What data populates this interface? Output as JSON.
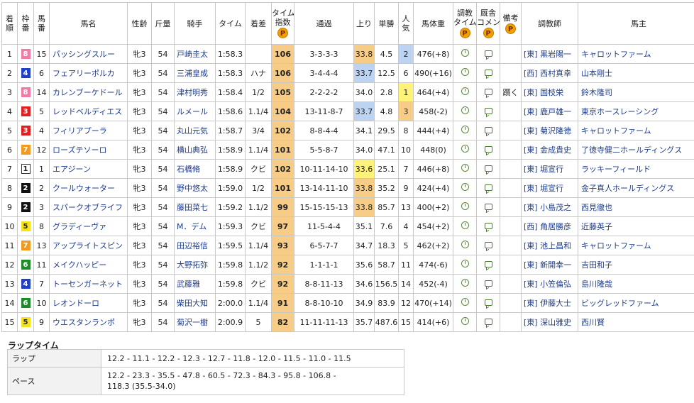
{
  "headers": {
    "rank": [
      "着",
      "順"
    ],
    "waku": [
      "枠",
      "番"
    ],
    "umaban": [
      "馬",
      "番"
    ],
    "name": "馬名",
    "sexage": "性齢",
    "weight": "斤量",
    "jockey": "騎手",
    "time": "タイム",
    "margin": "着差",
    "index": [
      "タイム",
      "指数"
    ],
    "passing": "通過",
    "last3f": "上り",
    "odds": "単勝",
    "pop": [
      "人",
      "気"
    ],
    "bodyweight": "馬体重",
    "training": [
      "調教",
      "タイム"
    ],
    "comment": [
      "厩舎",
      "コメント"
    ],
    "note": "備考",
    "trainer": "調教師",
    "owner": "馬主",
    "premium_badge": "P"
  },
  "rows": [
    {
      "rank": "1",
      "waku": "8",
      "umaban": "15",
      "name": "パッシングスルー",
      "sexage": "牝3",
      "weight": "54",
      "jockey": "戸崎圭太",
      "time": "1:58.3",
      "margin": "",
      "index": "106",
      "passing": "3-3-3-3",
      "last3f": "33.8",
      "odds": "4.5",
      "pop": "2",
      "bodyweight": "476(+8)",
      "note": "",
      "trainer": "[東] 黒岩陽一",
      "owner": "キャロットファーム",
      "l3": "orange",
      "pp": "blue"
    },
    {
      "rank": "2",
      "waku": "4",
      "umaban": "6",
      "name": "フェアリーポルカ",
      "sexage": "牝3",
      "weight": "54",
      "jockey": "三浦皇成",
      "time": "1:58.3",
      "margin": "ハナ",
      "index": "106",
      "passing": "3-4-4-4",
      "last3f": "33.7",
      "odds": "12.5",
      "pop": "6",
      "bodyweight": "490(+16)",
      "note": "",
      "trainer": "[西] 西村真幸",
      "owner": "山本剛士",
      "l3": "blue",
      "pp": "none"
    },
    {
      "rank": "3",
      "waku": "8",
      "umaban": "14",
      "name": "カレンブーケドール",
      "sexage": "牝3",
      "weight": "54",
      "jockey": "津村明秀",
      "time": "1:58.4",
      "margin": "1/2",
      "index": "105",
      "passing": "2-2-2-2",
      "last3f": "34.0",
      "odds": "2.8",
      "pop": "1",
      "bodyweight": "464(+4)",
      "note": "躓く",
      "trainer": "[東] 国枝栄",
      "owner": "鈴木隆司",
      "l3": "none",
      "pp": "yellow"
    },
    {
      "rank": "4",
      "waku": "3",
      "umaban": "5",
      "name": "レッドベルディエス",
      "sexage": "牝3",
      "weight": "54",
      "jockey": "ルメール",
      "time": "1:58.6",
      "margin": "1.1/4",
      "index": "104",
      "passing": "13-11-8-7",
      "last3f": "33.7",
      "odds": "4.8",
      "pop": "3",
      "bodyweight": "458(-2)",
      "note": "",
      "trainer": "[東] 鹿戸雄一",
      "owner": "東京ホースレーシング",
      "l3": "blue",
      "pp": "orange"
    },
    {
      "rank": "5",
      "waku": "3",
      "umaban": "4",
      "name": "フィリアプーラ",
      "sexage": "牝3",
      "weight": "54",
      "jockey": "丸山元気",
      "time": "1:58.7",
      "margin": "3/4",
      "index": "102",
      "passing": "8-8-4-4",
      "last3f": "34.1",
      "odds": "29.5",
      "pop": "8",
      "bodyweight": "444(+4)",
      "note": "",
      "trainer": "[東] 菊沢隆徳",
      "owner": "キャロットファーム",
      "l3": "none",
      "pp": "none"
    },
    {
      "rank": "6",
      "waku": "7",
      "umaban": "12",
      "name": "ローズテソーロ",
      "sexage": "牝3",
      "weight": "54",
      "jockey": "横山典弘",
      "time": "1:58.9",
      "margin": "1.1/4",
      "index": "101",
      "passing": "5-5-8-7",
      "last3f": "34.0",
      "odds": "47.1",
      "pop": "10",
      "bodyweight": "448(0)",
      "note": "",
      "trainer": "[東] 金成貴史",
      "owner": "了徳寺健二ホールディングス",
      "l3": "none",
      "pp": "none"
    },
    {
      "rank": "7",
      "waku": "1",
      "umaban": "1",
      "name": "エアジーン",
      "sexage": "牝3",
      "weight": "54",
      "jockey": "石橋脩",
      "time": "1:58.9",
      "margin": "クビ",
      "index": "102",
      "passing": "10-11-14-10",
      "last3f": "33.6",
      "odds": "25.1",
      "pop": "7",
      "bodyweight": "446(+8)",
      "note": "",
      "trainer": "[東] 堀宣行",
      "owner": "ラッキーフィールド",
      "l3": "yellow",
      "pp": "none"
    },
    {
      "rank": "8",
      "waku": "2",
      "umaban": "2",
      "name": "クールウォーター",
      "sexage": "牝3",
      "weight": "54",
      "jockey": "野中悠太",
      "time": "1:59.0",
      "margin": "1/2",
      "index": "101",
      "passing": "13-14-11-10",
      "last3f": "33.8",
      "odds": "35.2",
      "pop": "9",
      "bodyweight": "424(+4)",
      "note": "",
      "trainer": "[東] 堀宣行",
      "owner": "金子真人ホールディングス",
      "l3": "orange",
      "pp": "none"
    },
    {
      "rank": "9",
      "waku": "2",
      "umaban": "3",
      "name": "スパークオブライフ",
      "sexage": "牝3",
      "weight": "54",
      "jockey": "藤田菜七",
      "time": "1:59.2",
      "margin": "1.1/2",
      "index": "99",
      "passing": "15-15-15-13",
      "last3f": "33.8",
      "odds": "85.7",
      "pop": "13",
      "bodyweight": "400(+2)",
      "note": "",
      "trainer": "[東] 小島茂之",
      "owner": "西見徹也",
      "l3": "orange",
      "pp": "none"
    },
    {
      "rank": "10",
      "waku": "5",
      "umaban": "8",
      "name": "グラディーヴァ",
      "sexage": "牝3",
      "weight": "54",
      "jockey": "M．デム",
      "time": "1:59.3",
      "margin": "クビ",
      "index": "97",
      "passing": "11-5-4-4",
      "last3f": "35.1",
      "odds": "7.6",
      "pop": "4",
      "bodyweight": "454(+2)",
      "note": "",
      "trainer": "[西] 角居勝彦",
      "owner": "近藤英子",
      "l3": "none",
      "pp": "none"
    },
    {
      "rank": "11",
      "waku": "7",
      "umaban": "13",
      "name": "アップライトスピン",
      "sexage": "牝3",
      "weight": "54",
      "jockey": "田辺裕信",
      "time": "1:59.5",
      "margin": "1.1/4",
      "index": "93",
      "passing": "6-5-7-7",
      "last3f": "34.7",
      "odds": "18.3",
      "pop": "5",
      "bodyweight": "462(+2)",
      "note": "",
      "trainer": "[東] 池上昌和",
      "owner": "キャロットファーム",
      "l3": "none",
      "pp": "none"
    },
    {
      "rank": "12",
      "waku": "6",
      "umaban": "11",
      "name": "メイクハッピー",
      "sexage": "牝3",
      "weight": "54",
      "jockey": "大野拓弥",
      "time": "1:59.8",
      "margin": "1.1/2",
      "index": "92",
      "passing": "1-1-1-1",
      "last3f": "35.6",
      "odds": "58.7",
      "pop": "11",
      "bodyweight": "474(-6)",
      "note": "",
      "trainer": "[東] 新開幸一",
      "owner": "吉田和子",
      "l3": "none",
      "pp": "none"
    },
    {
      "rank": "13",
      "waku": "4",
      "umaban": "7",
      "name": "トーセンガーネット",
      "sexage": "牝3",
      "weight": "54",
      "jockey": "武藤雅",
      "time": "1:59.8",
      "margin": "クビ",
      "index": "92",
      "passing": "8-8-11-13",
      "last3f": "34.6",
      "odds": "156.5",
      "pop": "14",
      "bodyweight": "452(-4)",
      "note": "",
      "trainer": "[東] 小笠倫弘",
      "owner": "島川隆哉",
      "l3": "none",
      "pp": "none"
    },
    {
      "rank": "14",
      "waku": "6",
      "umaban": "10",
      "name": "レオンドーロ",
      "sexage": "牝3",
      "weight": "54",
      "jockey": "柴田大知",
      "time": "2:00.0",
      "margin": "1.1/4",
      "index": "91",
      "passing": "8-8-10-10",
      "last3f": "34.9",
      "odds": "83.9",
      "pop": "12",
      "bodyweight": "470(+14)",
      "note": "",
      "trainer": "[東] 伊藤大士",
      "owner": "ビッグレッドファーム",
      "l3": "none",
      "pp": "none"
    },
    {
      "rank": "15",
      "waku": "5",
      "umaban": "9",
      "name": "ウエスタンランポ",
      "sexage": "牝3",
      "weight": "54",
      "jockey": "菊沢一樹",
      "time": "2:00.9",
      "margin": "5",
      "index": "82",
      "passing": "11-11-11-13",
      "last3f": "35.7",
      "odds": "487.6",
      "pop": "15",
      "bodyweight": "414(+6)",
      "note": "",
      "trainer": "[東] 深山雅史",
      "owner": "西川賢",
      "l3": "none",
      "pp": "none"
    }
  ],
  "colors": {
    "waku": {
      "1": "#ffffff",
      "2": "#111111",
      "3": "#e02020",
      "4": "#2040c8",
      "5": "#f7e21a",
      "6": "#1f8a2a",
      "7": "#f39a1e",
      "8": "#f47aa6"
    },
    "waku_text": {
      "1": "#222222",
      "2": "#ffffff",
      "3": "#ffffff",
      "4": "#ffffff",
      "5": "#222222",
      "6": "#ffffff",
      "7": "#ffffff",
      "8": "#ffffff"
    },
    "highlight": {
      "orange": "#f6cc86",
      "blue": "#bcd3f2",
      "yellow": "#fff27a",
      "none": "transparent"
    },
    "index_bg": "#f6cc86"
  },
  "icons": {
    "training": "clock-icon",
    "comment": "speech-bubble-icon"
  },
  "lap": {
    "title": "ラップタイム",
    "lap_label": "ラップ",
    "lap_value": "12.2 - 11.1 - 12.2 - 12.3 - 12.7 - 11.8 - 12.0 - 11.5 - 11.0 - 11.5",
    "pace_label": "ペース",
    "pace_line1": "12.2 - 23.3 - 35.5 - 47.8 - 60.5 - 72.3 - 84.3 - 95.8 - 106.8 -",
    "pace_line2": "118.3 (35.5-34.0)"
  }
}
